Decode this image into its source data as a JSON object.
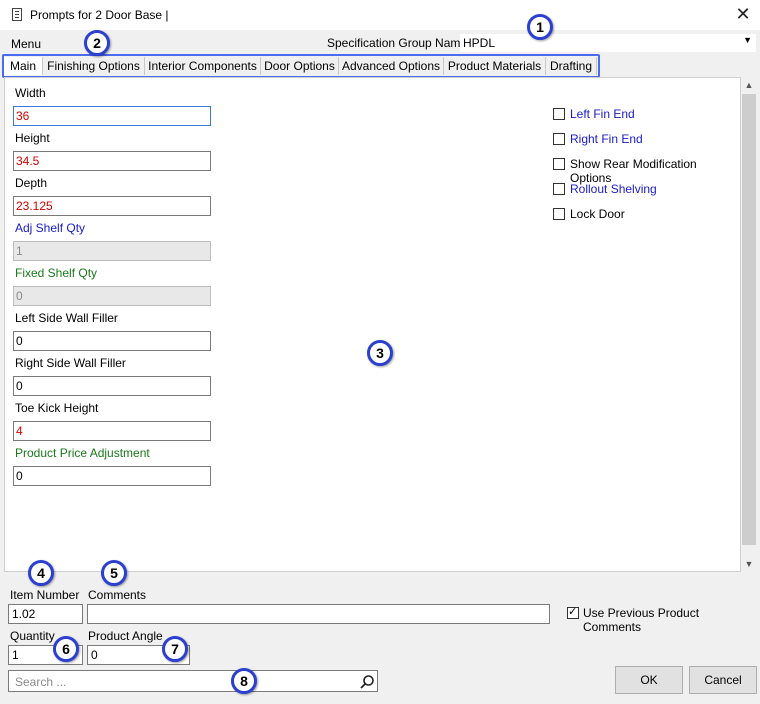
{
  "window": {
    "title": "Prompts for 2 Door Base |",
    "close_glyph": "✕"
  },
  "menubar": {
    "menu_label": "Menu",
    "spec_group_label": "Specification Group Name",
    "spec_group_value": "HPDL"
  },
  "tabs": [
    {
      "label": "Main",
      "active": true
    },
    {
      "label": "Finishing Options"
    },
    {
      "label": "Interior Components"
    },
    {
      "label": "Door Options"
    },
    {
      "label": "Advanced Options"
    },
    {
      "label": "Product Materials"
    },
    {
      "label": "Drafting"
    }
  ],
  "fields": {
    "width": {
      "label": "Width",
      "value": "36"
    },
    "height": {
      "label": "Height",
      "value": "34.5"
    },
    "depth": {
      "label": "Depth",
      "value": "23.125"
    },
    "adj_shelf_qty": {
      "label": "Adj Shelf Qty",
      "value": "1"
    },
    "fixed_shelf_qty": {
      "label": "Fixed Shelf Qty",
      "value": "0"
    },
    "left_side_wall_filler": {
      "label": "Left Side Wall Filler",
      "value": "0"
    },
    "right_side_wall_filler": {
      "label": "Right Side Wall Filler",
      "value": "0"
    },
    "toe_kick_height": {
      "label": "Toe Kick Height",
      "value": "4"
    },
    "product_price_adjustment": {
      "label": "Product Price Adjustment",
      "value": "0"
    }
  },
  "checkboxes": [
    {
      "label": "Left Fin End",
      "checked": false
    },
    {
      "label": "Right Fin End",
      "checked": false
    },
    {
      "label": "Show Rear Modification Options",
      "checked": false
    },
    {
      "label": "Rollout Shelving",
      "checked": false
    },
    {
      "label": "Lock Door",
      "checked": false
    }
  ],
  "bottom": {
    "item_number_label": "Item Number",
    "item_number_value": "1.02",
    "comments_label": "Comments",
    "comments_value": "",
    "use_previous_comments_label": "Use Previous Product Comments",
    "use_previous_comments_checked": true,
    "quantity_label": "Quantity",
    "quantity_value": "1",
    "product_angle_label": "Product Angle",
    "product_angle_value": "0",
    "search_placeholder": "Search ...",
    "ok_label": "OK",
    "cancel_label": "Cancel"
  },
  "callouts": [
    "1",
    "2",
    "3",
    "4",
    "5",
    "6",
    "7",
    "8"
  ],
  "colors": {
    "callout_border": "#2b3fd1",
    "tab_outline": "#4a6cf0",
    "label_blue": "#1a1ac8",
    "label_green": "#1a7a1a",
    "value_red": "#d10000"
  }
}
